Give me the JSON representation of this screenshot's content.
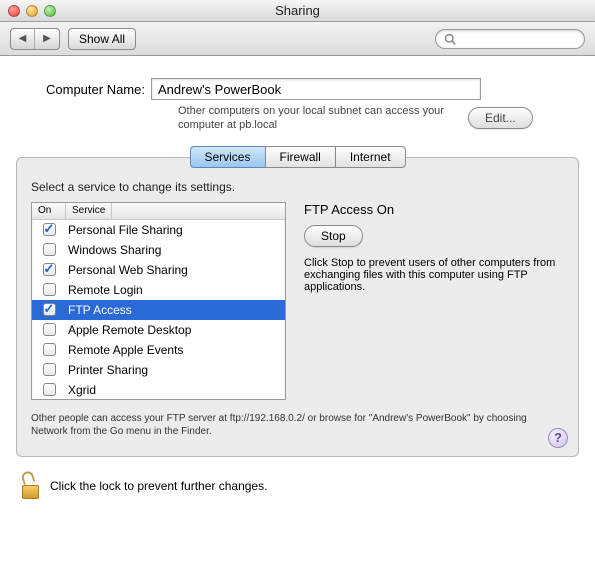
{
  "window": {
    "title": "Sharing"
  },
  "toolbar": {
    "show_all": "Show All",
    "search_placeholder": ""
  },
  "computer_name": {
    "label": "Computer Name:",
    "value": "Andrew's PowerBook",
    "subtext": "Other computers on your local subnet can access your computer at pb.local",
    "edit_button": "Edit..."
  },
  "tabs": {
    "services": "Services",
    "firewall": "Firewall",
    "internet": "Internet",
    "active": "services"
  },
  "panel": {
    "instruction": "Select a service to change its settings.",
    "columns": {
      "on": "On",
      "service": "Service"
    },
    "services": [
      {
        "name": "Personal File Sharing",
        "on": true,
        "selected": false
      },
      {
        "name": "Windows Sharing",
        "on": false,
        "selected": false
      },
      {
        "name": "Personal Web Sharing",
        "on": true,
        "selected": false
      },
      {
        "name": "Remote Login",
        "on": false,
        "selected": false
      },
      {
        "name": "FTP Access",
        "on": true,
        "selected": true
      },
      {
        "name": "Apple Remote Desktop",
        "on": false,
        "selected": false
      },
      {
        "name": "Remote Apple Events",
        "on": false,
        "selected": false
      },
      {
        "name": "Printer Sharing",
        "on": false,
        "selected": false
      },
      {
        "name": "Xgrid",
        "on": false,
        "selected": false
      }
    ],
    "detail": {
      "title": "FTP Access On",
      "button": "Stop",
      "description": "Click Stop to prevent users of other computers from exchanging files with this computer using FTP applications."
    },
    "footer": "Other people can access your FTP server at ftp://192.168.0.2/ or browse for \"Andrew's PowerBook\" by choosing Network from the Go menu in the Finder.",
    "help": "?"
  },
  "lock": {
    "text": "Click the lock to prevent further changes."
  }
}
